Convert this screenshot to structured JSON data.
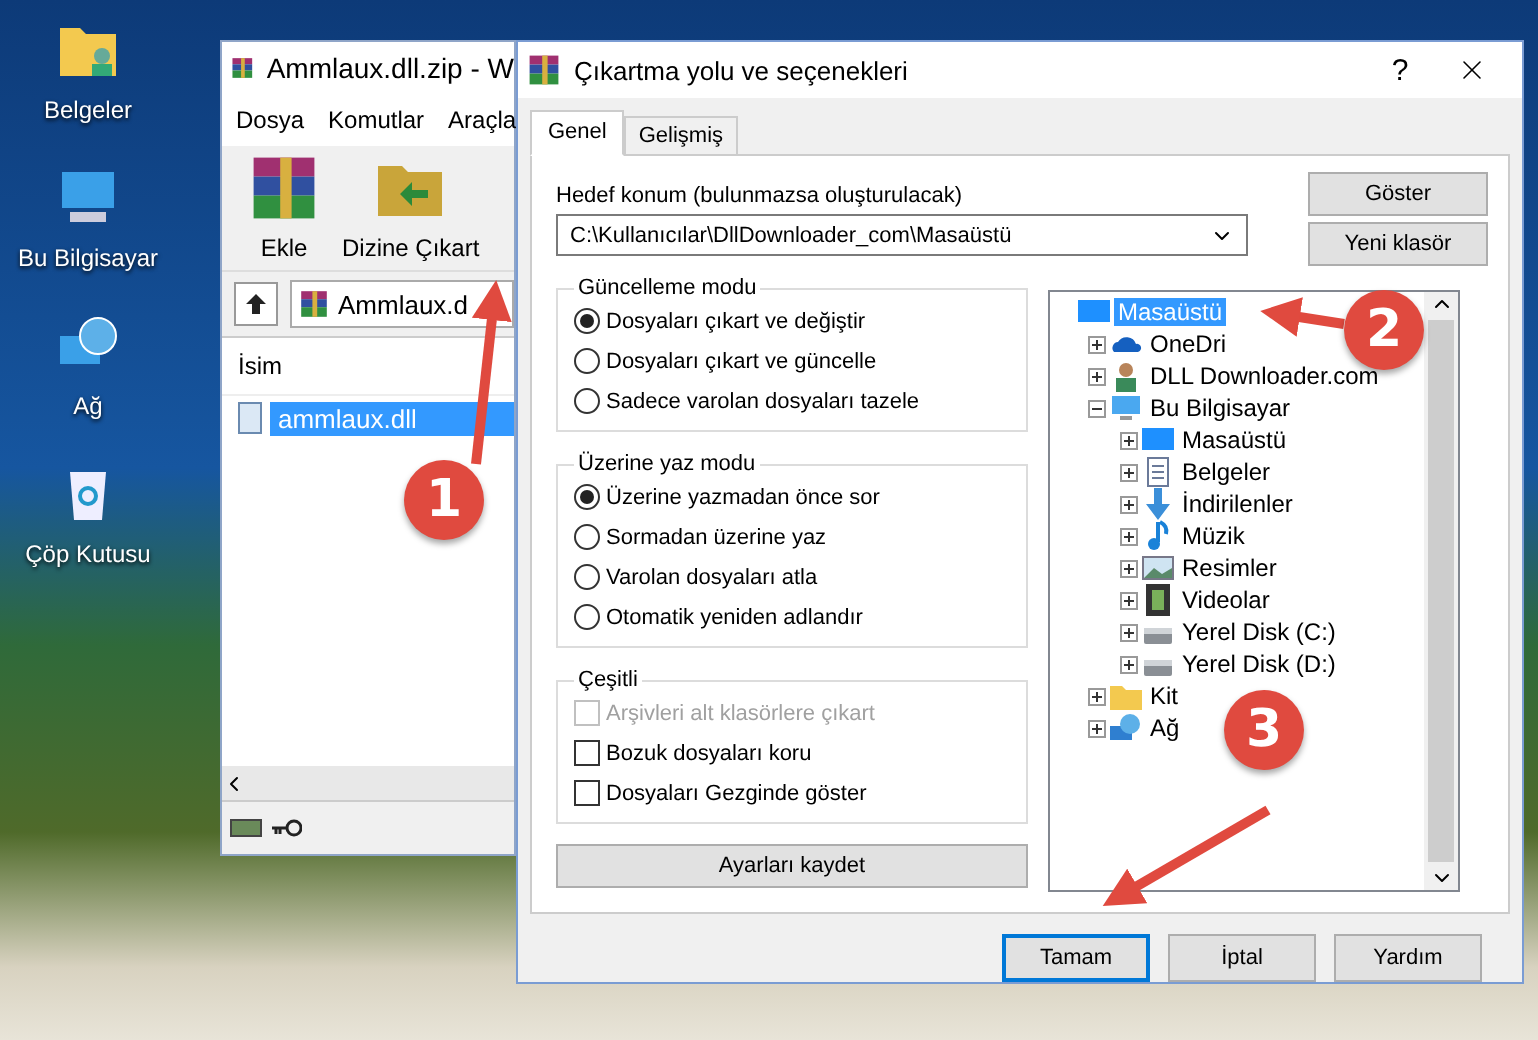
{
  "desktop": {
    "icons": [
      {
        "label": "Belgeler",
        "kind": "documents"
      },
      {
        "label": "Bu Bilgisayar",
        "kind": "computer"
      },
      {
        "label": "Ağ",
        "kind": "network"
      },
      {
        "label": "Çöp Kutusu",
        "kind": "recycle"
      }
    ]
  },
  "archive_window": {
    "title": "Ammlaux.dll.zip - W",
    "menu": [
      "Dosya",
      "Komutlar",
      "Araçla"
    ],
    "toolbar": [
      {
        "label": "Ekle",
        "kind": "add"
      },
      {
        "label": "Dizine Çıkart",
        "kind": "extract"
      }
    ],
    "path": "Ammlaux.d",
    "column": "İsim",
    "files": [
      {
        "name": "ammlaux.dll",
        "selected": true
      }
    ]
  },
  "dialog": {
    "title": "Çıkartma yolu ve seçenekleri",
    "help": "?",
    "tabs": [
      {
        "label": "Genel",
        "selected": true
      },
      {
        "label": "Gelişmiş",
        "selected": false
      }
    ],
    "destination_label": "Hedef konum (bulunmazsa oluşturulacak)",
    "destination": "C:\\Kullanıcılar\\DllDownloader_com\\Masaüstü",
    "side_buttons": [
      "Göster",
      "Yeni klasör"
    ],
    "groups": [
      {
        "title": "Güncelleme modu",
        "options": [
          {
            "kind": "radio",
            "label": "Dosyaları çıkart ve değiştir",
            "checked": true,
            "disabled": false
          },
          {
            "kind": "radio",
            "label": "Dosyaları çıkart ve güncelle",
            "checked": false,
            "disabled": false
          },
          {
            "kind": "radio",
            "label": "Sadece varolan dosyaları tazele",
            "checked": false,
            "disabled": false
          }
        ]
      },
      {
        "title": "Üzerine yaz modu",
        "options": [
          {
            "kind": "radio",
            "label": "Üzerine yazmadan önce sor",
            "checked": true,
            "disabled": false
          },
          {
            "kind": "radio",
            "label": "Sormadan üzerine yaz",
            "checked": false,
            "disabled": false
          },
          {
            "kind": "radio",
            "label": "Varolan dosyaları atla",
            "checked": false,
            "disabled": false
          },
          {
            "kind": "radio",
            "label": "Otomatik yeniden adlandır",
            "checked": false,
            "disabled": false
          }
        ]
      },
      {
        "title": "Çeşitli",
        "options": [
          {
            "kind": "checkbox",
            "label": "Arşivleri alt klasörlere çıkart",
            "checked": false,
            "disabled": true
          },
          {
            "kind": "checkbox",
            "label": "Bozuk dosyaları koru",
            "checked": false,
            "disabled": false
          },
          {
            "kind": "checkbox",
            "label": "Dosyaları Gezginde göster",
            "checked": false,
            "disabled": false
          }
        ]
      }
    ],
    "save_button": "Ayarları kaydet",
    "tree": [
      {
        "label": "Masaüstü",
        "kind": "desktop",
        "selected": true,
        "children": [
          {
            "label": "OneDri",
            "kind": "cloud",
            "selected": false,
            "expanded": false
          },
          {
            "label": "DLL Downloader.com",
            "kind": "user",
            "selected": false,
            "expanded": false
          },
          {
            "label": "Bu Bilgisayar",
            "kind": "computer",
            "selected": false,
            "expanded": true,
            "children": [
              {
                "label": "Masaüstü",
                "kind": "desktop",
                "selected": false,
                "expanded": false
              },
              {
                "label": "Belgeler",
                "kind": "documents",
                "selected": false,
                "expanded": false
              },
              {
                "label": "İndirilenler",
                "kind": "download",
                "selected": false,
                "expanded": false
              },
              {
                "label": "Müzik",
                "kind": "music",
                "selected": false,
                "expanded": false
              },
              {
                "label": "Resimler",
                "kind": "pictures",
                "selected": false,
                "expanded": false
              },
              {
                "label": "Videolar",
                "kind": "video",
                "selected": false,
                "expanded": false
              },
              {
                "label": "Yerel Disk (C:)",
                "kind": "drive",
                "selected": false,
                "expanded": false
              },
              {
                "label": "Yerel Disk (D:)",
                "kind": "drive",
                "selected": false,
                "expanded": false
              }
            ]
          },
          {
            "label": "Kit",
            "kind": "folder",
            "selected": false,
            "expanded": false
          },
          {
            "label": "Ağ",
            "kind": "network",
            "selected": false,
            "expanded": false
          }
        ]
      }
    ],
    "buttons": [
      {
        "label": "Tamam",
        "default": true
      },
      {
        "label": "İptal",
        "default": false
      },
      {
        "label": "Yardım",
        "default": false
      }
    ]
  },
  "annotations": [
    {
      "number": "1"
    },
    {
      "number": "2"
    },
    {
      "number": "3"
    }
  ]
}
